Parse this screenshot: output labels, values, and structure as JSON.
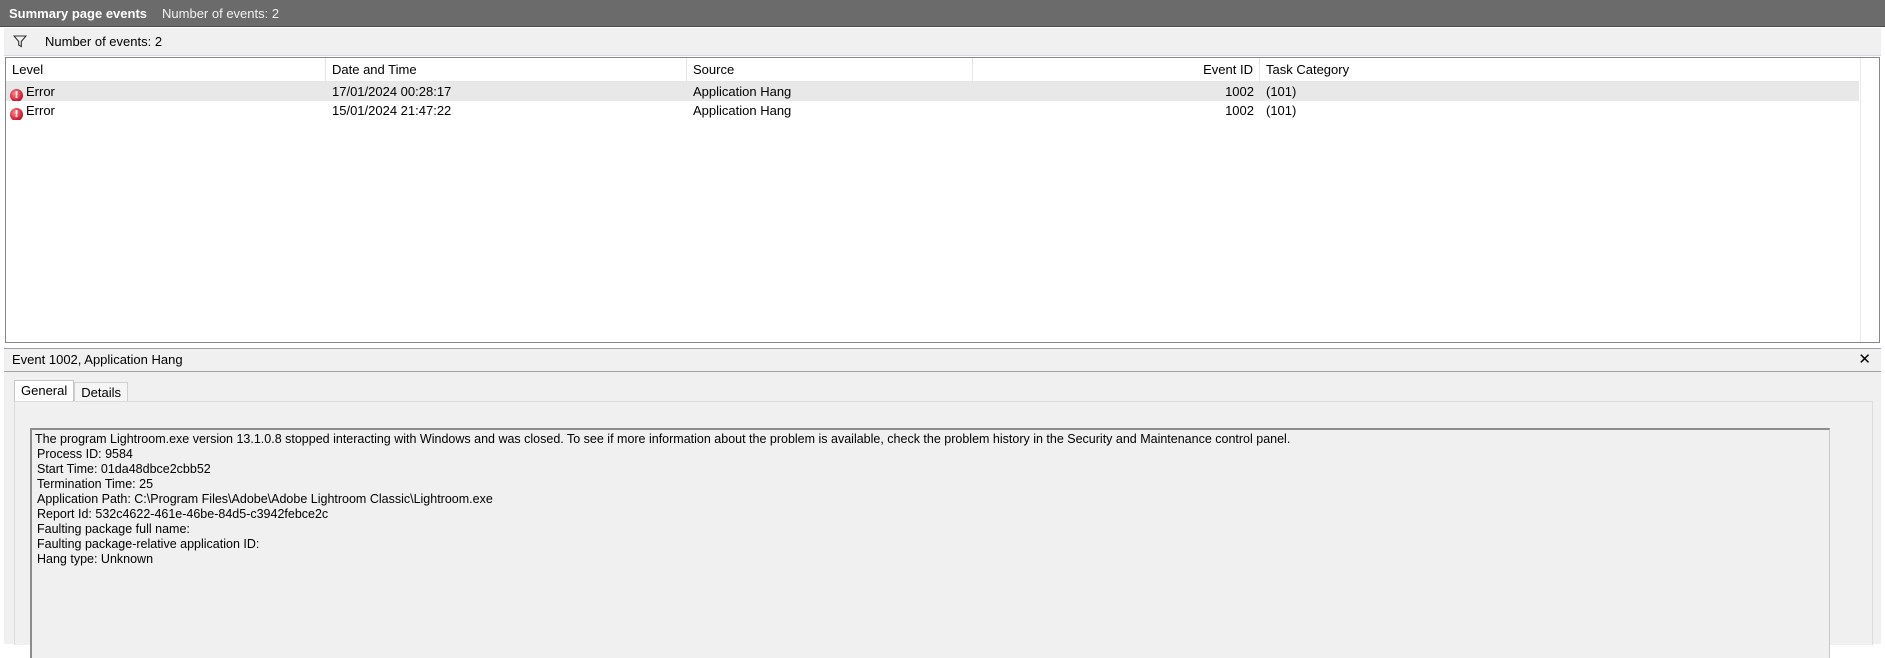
{
  "titlebar": {
    "title": "Summary page events",
    "count": "Number of events: 2"
  },
  "filterbar": {
    "icon": "filter-icon",
    "count": "Number of events: 2"
  },
  "grid": {
    "columns": [
      "Level",
      "Date and Time",
      "Source",
      "Event ID",
      "Task Category"
    ],
    "rows": [
      {
        "level": "Error",
        "datetime": "17/01/2024 00:28:17",
        "source": "Application Hang",
        "event_id": "1002",
        "task_category": "(101)"
      },
      {
        "level": "Error",
        "datetime": "15/01/2024 21:47:22",
        "source": "Application Hang",
        "event_id": "1002",
        "task_category": "(101)"
      }
    ]
  },
  "detail": {
    "title": "Event 1002, Application Hang",
    "close": "✕",
    "tabs": [
      "General",
      "Details"
    ],
    "lines": [
      "The program Lightroom.exe version 13.1.0.8 stopped interacting with Windows and was closed. To see if more information about the problem is available, check the problem history in the Security and Maintenance control panel.",
      "Process ID: 9584",
      "Start Time: 01da48dbce2cbb52",
      "Termination Time: 25",
      "Application Path: C:\\Program Files\\Adobe\\Adobe Lightroom Classic\\Lightroom.exe",
      "Report Id: 532c4622-461e-46be-84d5-c3942febce2c",
      "Faulting package full name:",
      "Faulting package-relative application ID:",
      "Hang type: Unknown"
    ]
  },
  "colors": {
    "titlebar_bg": "#6b6b6b",
    "selected_row": "#e8e8e8",
    "error_icon": "#c8102e"
  }
}
